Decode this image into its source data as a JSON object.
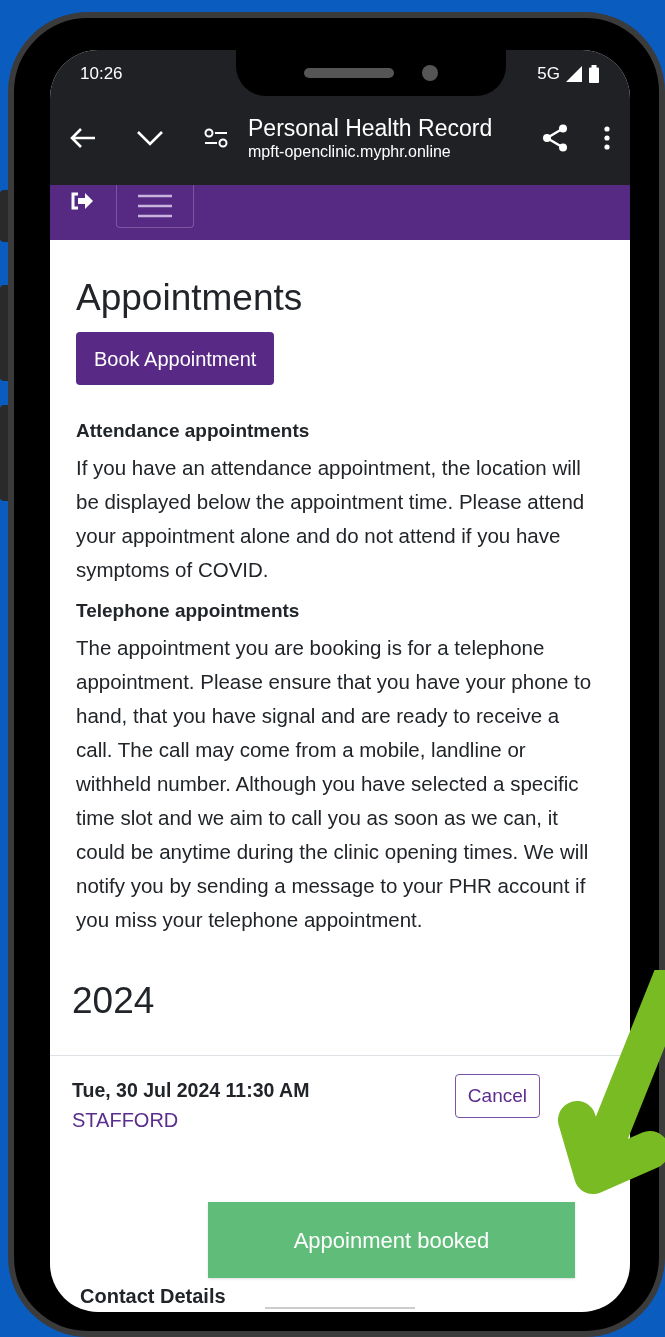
{
  "status_bar": {
    "time": "10:26",
    "network": "5G"
  },
  "browser": {
    "title": "Personal Health Record",
    "url": "mpft-openclinic.myphr.online"
  },
  "page": {
    "heading": "Appointments",
    "book_button": "Book Appointment",
    "sections": [
      {
        "heading": "Attendance appointments",
        "body": "If you have an attendance appointment, the location will be displayed below the appointment time. Please attend your appointment alone and do not attend if you have symptoms of COVID."
      },
      {
        "heading": "Telephone appointments",
        "body": "The appointment you are booking is for a telephone appointment. Please ensure that you have your phone to hand, that you have signal and are ready to receive a call. The call may come from a mobile, landline or withheld number. Although you have selected a specific time slot and we aim to call you as soon as we can, it could be anytime during the clinic opening times. We will notify you by sending a message to your PHR account if you miss your telephone appointment."
      }
    ],
    "year": "2024",
    "appointments": [
      {
        "datetime": "Tue, 30 Jul 2024 11:30 AM",
        "location": "STAFFORD",
        "action": "Cancel"
      }
    ],
    "footer_heading": "Contact Details"
  },
  "toast": "Appoinment booked"
}
